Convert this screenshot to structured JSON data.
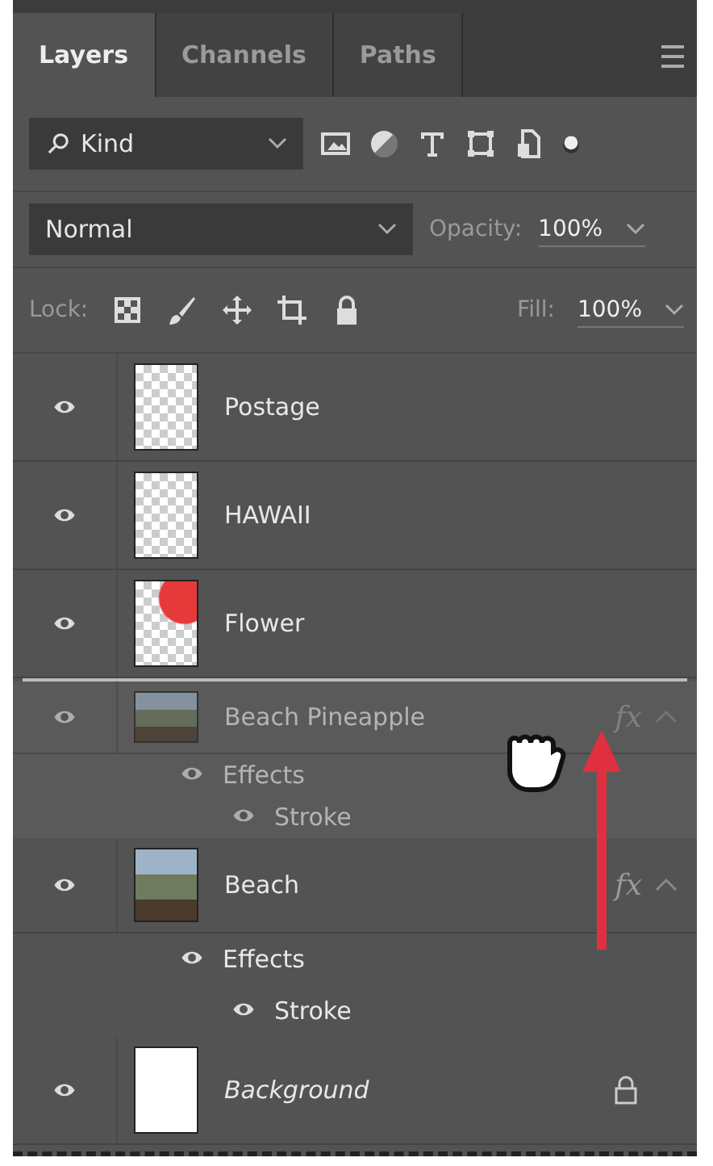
{
  "tabs": [
    {
      "label": "Layers",
      "selected": true
    },
    {
      "label": "Channels",
      "selected": false
    },
    {
      "label": "Paths",
      "selected": false
    }
  ],
  "filter": {
    "value": "Kind"
  },
  "blend_mode": {
    "value": "Normal"
  },
  "opacity": {
    "label": "Opacity:",
    "value": "100%"
  },
  "lock": {
    "label": "Lock:"
  },
  "fill": {
    "label": "Fill:",
    "value": "100%"
  },
  "layers": [
    {
      "name": "Postage",
      "kind": "transparent",
      "visible": true,
      "dragging": false
    },
    {
      "name": "HAWAII",
      "kind": "transparent",
      "visible": true,
      "dragging": false
    },
    {
      "name": "Flower",
      "kind": "flower",
      "visible": true,
      "dragging": false
    },
    {
      "name": "Beach Pineapple",
      "kind": "photo",
      "visible": true,
      "dragging": true,
      "fx": "fx",
      "expanded": true,
      "effects": {
        "label": "Effects",
        "visible": true,
        "items": [
          {
            "name": "Stroke",
            "visible": true
          }
        ]
      }
    },
    {
      "name": "Beach",
      "kind": "photo",
      "visible": true,
      "dragging": false,
      "fx": "fx",
      "expanded": true,
      "effects": {
        "label": "Effects",
        "visible": true,
        "items": [
          {
            "name": "Stroke",
            "visible": true
          }
        ]
      }
    },
    {
      "name": "Background",
      "kind": "background",
      "visible": true,
      "dragging": false,
      "locked": true
    }
  ]
}
